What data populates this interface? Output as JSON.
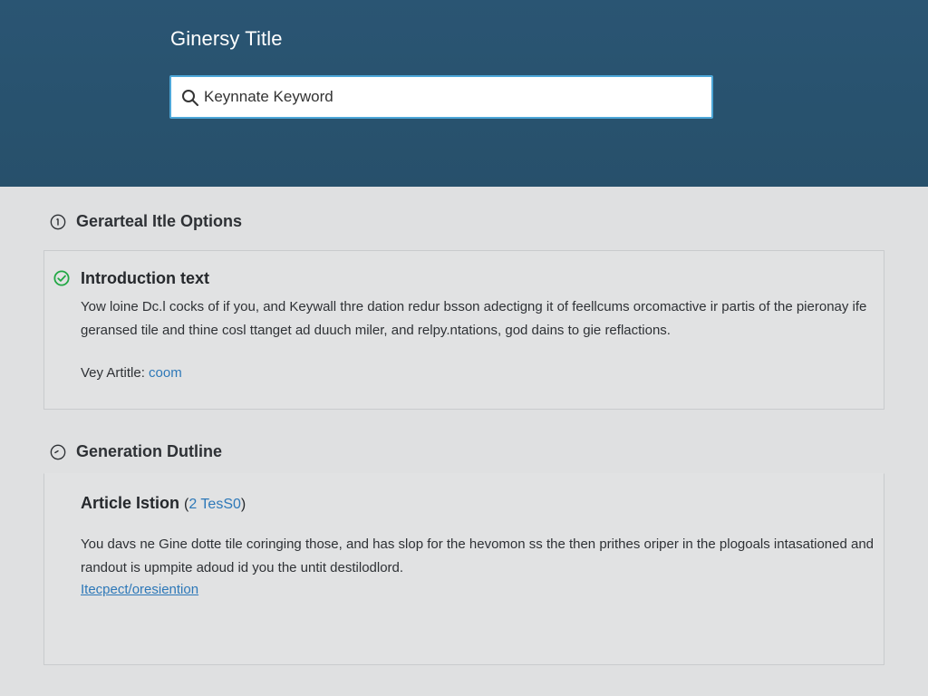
{
  "header": {
    "title": "Ginersy Title",
    "background_color": "#27506b"
  },
  "search": {
    "icon": "search-icon",
    "value": "Keynnate Keyword",
    "border_color": "#4da7d8"
  },
  "sections": [
    {
      "heading": "Gerarteal Itle Options",
      "icon": "circle-info-icon",
      "card": {
        "title": "Introduction text",
        "status_icon": "check-circle-icon",
        "status_color": "#22a845",
        "body": "Yow loine Dc.l cocks of if you, and Keywall thre dation redur bsson adectigng it of feellcums orcomactive ir partis of the pieronay ife geransed tile and thine cosl ttanget ad duuch miler, and relpy.ntations, god dains to gie reflactions.",
        "meta_label": "Vey Artitle:",
        "meta_link": "coom"
      }
    },
    {
      "heading": "Generation Dutline",
      "icon": "circle-clock-icon",
      "card": {
        "title": "Article Istion",
        "title_link_open": "(",
        "title_link": "2 TesS0",
        "title_link_close": ")",
        "body": "You davs ne Gine dotte tile coringing those, and has slop for the hevomon ss the then prithes oriper in the plogoals intasationed and randout is upmpite adoud id you the untit destilodlord.",
        "link": "Itecpect/oresiention"
      }
    }
  ],
  "colors": {
    "page_background": "#dfe0e1",
    "link": "#2d78b8"
  }
}
